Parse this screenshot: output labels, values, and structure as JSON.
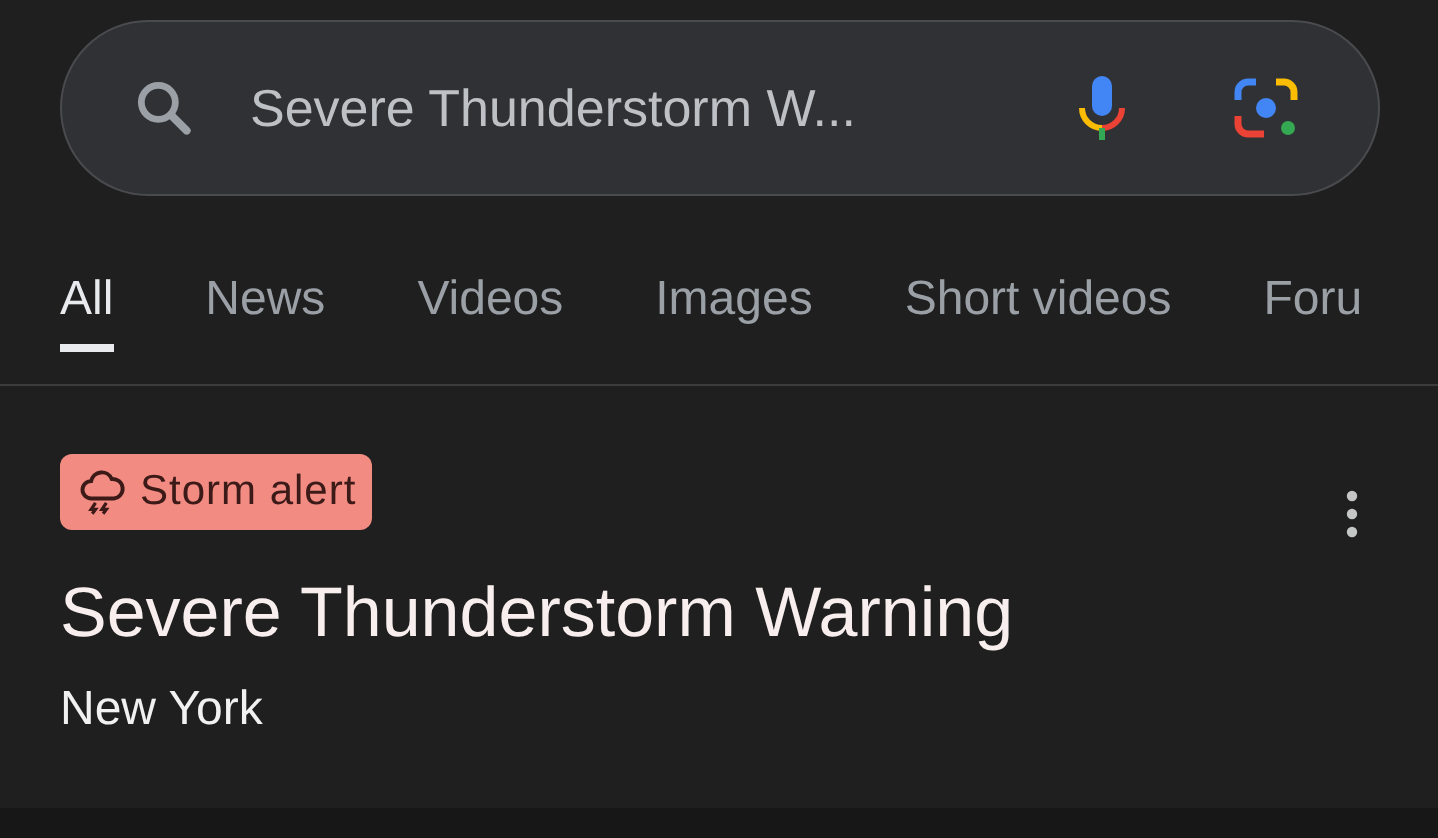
{
  "search": {
    "value": "Severe Thunderstorm W..."
  },
  "tabs": [
    {
      "label": "All",
      "selected": true
    },
    {
      "label": "News",
      "selected": false
    },
    {
      "label": "Videos",
      "selected": false
    },
    {
      "label": "Images",
      "selected": false
    },
    {
      "label": "Short videos",
      "selected": false
    },
    {
      "label": "Foru",
      "selected": false
    }
  ],
  "alert": {
    "badge": "Storm alert",
    "title": "Severe Thunderstorm Warning",
    "location": "New York"
  }
}
